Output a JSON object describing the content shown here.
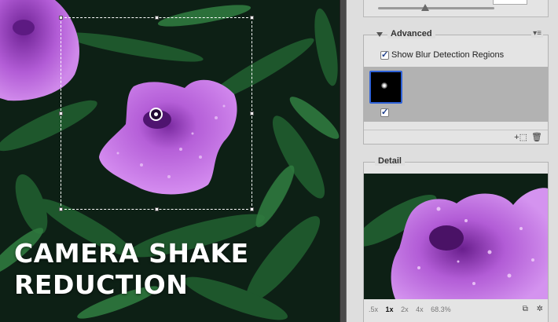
{
  "canvas": {
    "overlay_title_line1": "CAMERA SHAKE",
    "overlay_title_line2": "REDUCTION"
  },
  "panel": {
    "advanced": {
      "title": "Advanced",
      "show_blur_regions_label": "Show Blur Detection Regions",
      "show_blur_regions_checked": true,
      "blur_trace_checked": true
    },
    "detail": {
      "title": "Detail",
      "zoom_levels": [
        ".5x",
        "1x",
        "2x",
        "4x",
        "68.3%"
      ],
      "active_zoom": "1x"
    }
  },
  "colors": {
    "selection_blue": "#2f62d8",
    "panel_bg": "#dedede",
    "petal": "#b86ad6"
  },
  "icons": {
    "advanced_disclosure": "triangle-down-icon",
    "advanced_menu": "panel-menu-icon",
    "add_trace": "add-blur-trace-icon",
    "delete_trace": "trash-icon",
    "detail_unlock": "unlock-detail-icon",
    "detail_enhance": "enhance-at-loupe-icon"
  }
}
